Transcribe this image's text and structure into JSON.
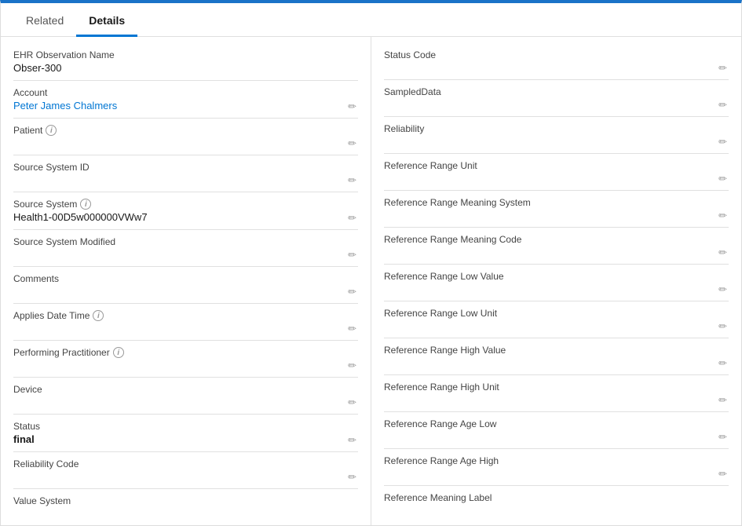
{
  "tabs": [
    {
      "id": "related",
      "label": "Related",
      "active": false
    },
    {
      "id": "details",
      "label": "Details",
      "active": true
    }
  ],
  "leftColumn": [
    {
      "id": "ehr-obs-name",
      "label": "EHR Observation Name",
      "value": "Obser-300",
      "hasInfo": false,
      "isLink": false,
      "isBold": false,
      "hasEdit": false
    },
    {
      "id": "account",
      "label": "Account",
      "value": "Peter James Chalmers",
      "hasInfo": false,
      "isLink": true,
      "isBold": false,
      "hasEdit": true
    },
    {
      "id": "patient",
      "label": "Patient",
      "value": "",
      "hasInfo": true,
      "isLink": false,
      "isBold": false,
      "hasEdit": true
    },
    {
      "id": "source-system-id",
      "label": "Source System ID",
      "value": "",
      "hasInfo": false,
      "isLink": false,
      "isBold": false,
      "hasEdit": true
    },
    {
      "id": "source-system",
      "label": "Source System",
      "value": "Health1-00D5w000000VWw7",
      "hasInfo": true,
      "isLink": false,
      "isBold": false,
      "hasEdit": true
    },
    {
      "id": "source-system-modified",
      "label": "Source System Modified",
      "value": "",
      "hasInfo": false,
      "isLink": false,
      "isBold": false,
      "hasEdit": true
    },
    {
      "id": "comments",
      "label": "Comments",
      "value": "",
      "hasInfo": false,
      "isLink": false,
      "isBold": false,
      "hasEdit": true
    },
    {
      "id": "applies-date-time",
      "label": "Applies Date Time",
      "value": "",
      "hasInfo": true,
      "isLink": false,
      "isBold": false,
      "hasEdit": true
    },
    {
      "id": "performing-practitioner",
      "label": "Performing Practitioner",
      "value": "",
      "hasInfo": true,
      "isLink": false,
      "isBold": false,
      "hasEdit": true
    },
    {
      "id": "device",
      "label": "Device",
      "value": "",
      "hasInfo": false,
      "isLink": false,
      "isBold": false,
      "hasEdit": true
    },
    {
      "id": "status",
      "label": "Status",
      "value": "final",
      "hasInfo": false,
      "isLink": false,
      "isBold": true,
      "hasEdit": true
    },
    {
      "id": "reliability-code",
      "label": "Reliability Code",
      "value": "",
      "hasInfo": false,
      "isLink": false,
      "isBold": false,
      "hasEdit": true
    },
    {
      "id": "value-system",
      "label": "Value System",
      "value": "",
      "hasInfo": false,
      "isLink": false,
      "isBold": false,
      "hasEdit": false
    }
  ],
  "rightColumn": [
    {
      "id": "status-code",
      "label": "Status Code",
      "value": "",
      "hasInfo": false,
      "isLink": false,
      "isBold": false,
      "hasEdit": true
    },
    {
      "id": "sampled-data",
      "label": "SampledData",
      "value": "",
      "hasInfo": false,
      "isLink": false,
      "isBold": false,
      "hasEdit": true
    },
    {
      "id": "reliability",
      "label": "Reliability",
      "value": "",
      "hasInfo": false,
      "isLink": false,
      "isBold": false,
      "hasEdit": true
    },
    {
      "id": "reference-range-unit",
      "label": "Reference Range Unit",
      "value": "",
      "hasInfo": false,
      "isLink": false,
      "isBold": false,
      "hasEdit": true
    },
    {
      "id": "reference-range-meaning-system",
      "label": "Reference Range Meaning System",
      "value": "",
      "hasInfo": false,
      "isLink": false,
      "isBold": false,
      "hasEdit": true
    },
    {
      "id": "reference-range-meaning-code",
      "label": "Reference Range Meaning Code",
      "value": "",
      "hasInfo": false,
      "isLink": false,
      "isBold": false,
      "hasEdit": true
    },
    {
      "id": "reference-range-low-value",
      "label": "Reference Range Low Value",
      "value": "",
      "hasInfo": false,
      "isLink": false,
      "isBold": false,
      "hasEdit": true
    },
    {
      "id": "reference-range-low-unit",
      "label": "Reference Range Low Unit",
      "value": "",
      "hasInfo": false,
      "isLink": false,
      "isBold": false,
      "hasEdit": true
    },
    {
      "id": "reference-range-high-value",
      "label": "Reference Range High Value",
      "value": "",
      "hasInfo": false,
      "isLink": false,
      "isBold": false,
      "hasEdit": true
    },
    {
      "id": "reference-range-high-unit",
      "label": "Reference Range High Unit",
      "value": "",
      "hasInfo": false,
      "isLink": false,
      "isBold": false,
      "hasEdit": true
    },
    {
      "id": "reference-range-age-low",
      "label": "Reference Range Age Low",
      "value": "",
      "hasInfo": false,
      "isLink": false,
      "isBold": false,
      "hasEdit": true
    },
    {
      "id": "reference-range-age-high",
      "label": "Reference Range Age High",
      "value": "",
      "hasInfo": false,
      "isLink": false,
      "isBold": false,
      "hasEdit": true
    },
    {
      "id": "reference-meaning-label",
      "label": "Reference Meaning Label",
      "value": "",
      "hasInfo": false,
      "isLink": false,
      "isBold": false,
      "hasEdit": false
    }
  ],
  "icons": {
    "edit": "✏",
    "info": "i"
  }
}
